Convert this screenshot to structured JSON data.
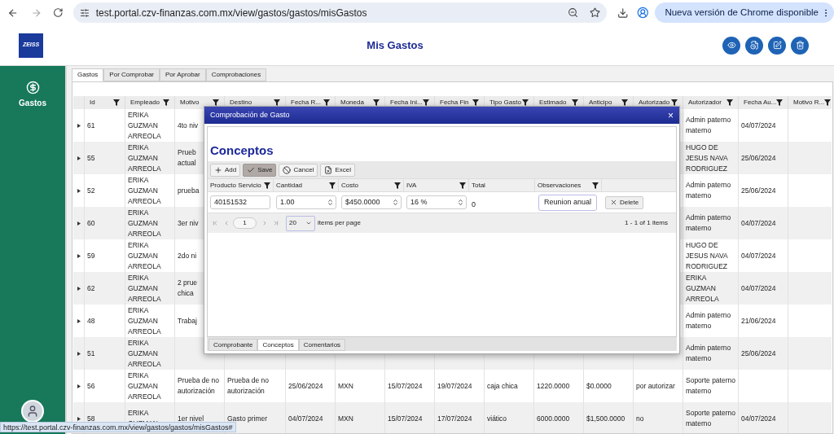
{
  "browser": {
    "url": "test.portal.czv-finanzas.com.mx/view/gastos/gastos/misGastos",
    "update_button": "Nueva versión de Chrome disponible",
    "status_link": "https://test.portal.czv-finanzas.com.mx/view/gastos/gastos/misGastos#"
  },
  "header": {
    "logo": "ZEISS",
    "title": "Mis Gastos"
  },
  "sidebar": {
    "items": [
      {
        "label": "Gastos"
      }
    ]
  },
  "tabs": [
    {
      "label": "Gastos",
      "selected": true
    },
    {
      "label": "Por Comprobar",
      "selected": false
    },
    {
      "label": "Por Aprobar",
      "selected": false
    },
    {
      "label": "Comprobaciones",
      "selected": false
    }
  ],
  "table": {
    "columns": [
      "Id",
      "Empleado",
      "Motivo",
      "Destino",
      "Fecha R...",
      "Moneda",
      "Fecha Ini...",
      "Fecha Fin",
      "Tipo Gasto",
      "Estimado",
      "Anticipo",
      "Autorizado",
      "Autorizador",
      "Fecha Au...",
      "Motivo R..."
    ],
    "rows": [
      {
        "cells": [
          "61",
          "ERIKA GUZMAN ARREOLA",
          "4to niv",
          null,
          null,
          null,
          null,
          null,
          null,
          null,
          null,
          null,
          "Admin paterno materno",
          "04/07/2024",
          null
        ]
      },
      {
        "cells": [
          "55",
          "ERIKA GUZMAN ARREOLA",
          "Prueb\nactual",
          null,
          null,
          null,
          null,
          null,
          null,
          null,
          null,
          null,
          "HUGO DE JESUS NAVA RODRIGUEZ",
          "25/06/2024",
          null
        ]
      },
      {
        "cells": [
          "52",
          "ERIKA GUZMAN ARREOLA",
          "prueba",
          null,
          null,
          null,
          null,
          null,
          null,
          null,
          null,
          null,
          "Admin paterno materno",
          "25/06/2024",
          null
        ]
      },
      {
        "cells": [
          "60",
          "ERIKA GUZMAN ARREOLA",
          "3er niv",
          null,
          null,
          null,
          null,
          null,
          null,
          null,
          null,
          null,
          "Admin paterno materno",
          "04/07/2024",
          null
        ]
      },
      {
        "cells": [
          "59",
          "ERIKA GUZMAN ARREOLA",
          "2do ni",
          null,
          null,
          null,
          null,
          null,
          null,
          null,
          null,
          null,
          "HUGO DE JESUS NAVA RODRIGUEZ",
          "04/07/2024",
          null
        ]
      },
      {
        "cells": [
          "62",
          "ERIKA GUZMAN ARREOLA",
          "2 prue\nchica",
          null,
          null,
          null,
          null,
          null,
          null,
          null,
          null,
          null,
          "ERIKA GUZMAN ARREOLA",
          "04/07/2024",
          null
        ]
      },
      {
        "cells": [
          "48",
          "ERIKA GUZMAN ARREOLA",
          "Trabaj",
          null,
          null,
          null,
          null,
          null,
          null,
          null,
          null,
          null,
          "Admin paterno materno",
          "21/06/2024",
          null
        ]
      },
      {
        "cells": [
          "51",
          "ERIKA GUZMAN ARREOLA",
          null,
          null,
          null,
          null,
          null,
          null,
          null,
          null,
          null,
          null,
          "Admin paterno materno",
          "25/06/2024",
          null
        ]
      },
      {
        "cells": [
          "56",
          "ERIKA GUZMAN ARREOLA",
          "Prueba de no autorización",
          "Prueba de no autorización",
          "25/06/2024",
          "MXN",
          "15/07/2024",
          "19/07/2024",
          "caja chica",
          "1220.0000",
          "$0.0000",
          "por autorizar",
          "Soporte paterno materno",
          null,
          null
        ]
      },
      {
        "cells": [
          "58",
          "ERIKA GUZMAN",
          "1er nivel",
          "Gasto primer",
          "04/07/2024",
          "MXN",
          "15/07/2024",
          "17/07/2024",
          "viático",
          "6000.0000",
          "$1,500.0000",
          "no",
          "Soporte paterno materno",
          "04/07/2024",
          null
        ]
      }
    ]
  },
  "modal": {
    "title": "Comprobación de Gasto",
    "close": "×",
    "heading": "Conceptos",
    "toolbar": [
      {
        "label": "Add",
        "kind": "add",
        "selected": false
      },
      {
        "label": "Save",
        "kind": "save",
        "selected": true
      },
      {
        "label": "Cancel",
        "kind": "cancel",
        "selected": false
      },
      {
        "label": "Excel",
        "kind": "excel",
        "selected": false
      }
    ],
    "grid": {
      "columns": [
        {
          "label": "Producto Servicio",
          "filterable": true
        },
        {
          "label": "Cantidad",
          "filterable": true
        },
        {
          "label": "Costo",
          "filterable": true
        },
        {
          "label": "IVA",
          "filterable": true
        },
        {
          "label": "Total",
          "filterable": false
        },
        {
          "label": "Observaciones",
          "filterable": true
        }
      ],
      "row": {
        "producto": "40151532",
        "cantidad": "1.00",
        "costo": "$450.0000",
        "iva": "16 %",
        "total": "0",
        "observaciones": "Reunion anual",
        "delete": "Delete"
      }
    },
    "pager": {
      "page": "1",
      "page_size": "20",
      "items_label": "items per page",
      "summary": "1 - 1 of 1 items"
    },
    "tabs": [
      {
        "label": "Comprobante",
        "selected": false
      },
      {
        "label": "Conceptos",
        "selected": true
      },
      {
        "label": "Comentarios",
        "selected": false
      }
    ]
  }
}
